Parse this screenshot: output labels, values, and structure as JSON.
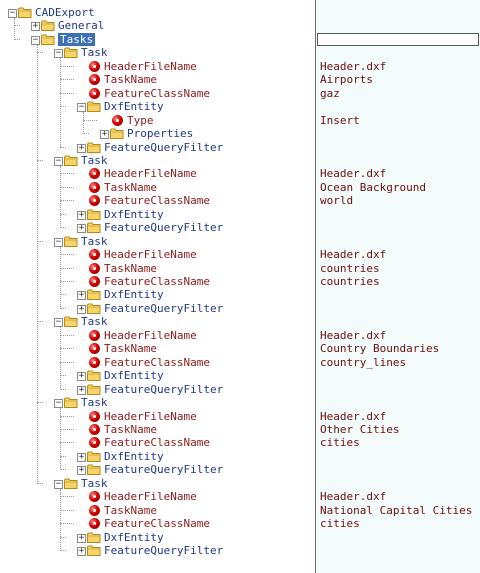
{
  "tree": [
    {
      "depth": 0,
      "kind": "folder",
      "label": "CADExport",
      "toggle": "-"
    },
    {
      "depth": 1,
      "kind": "folder",
      "label": "General",
      "toggle": "+"
    },
    {
      "depth": 1,
      "kind": "folder",
      "label": "Tasks",
      "toggle": "-",
      "selected": true,
      "editing": true
    },
    {
      "depth": 2,
      "kind": "folder",
      "label": "Task",
      "toggle": "-"
    },
    {
      "depth": 3,
      "kind": "leaf",
      "label": "HeaderFileName",
      "value": "Header.dxf"
    },
    {
      "depth": 3,
      "kind": "leaf",
      "label": "TaskName",
      "value": "Airports"
    },
    {
      "depth": 3,
      "kind": "leaf",
      "label": "FeatureClassName",
      "value": "gaz"
    },
    {
      "depth": 3,
      "kind": "folder",
      "label": "DxfEntity",
      "toggle": "-"
    },
    {
      "depth": 4,
      "kind": "leaf",
      "label": "Type",
      "value": "Insert"
    },
    {
      "depth": 4,
      "kind": "folder",
      "label": "Properties",
      "toggle": "+"
    },
    {
      "depth": 3,
      "kind": "folder",
      "label": "FeatureQueryFilter",
      "toggle": "+"
    },
    {
      "depth": 2,
      "kind": "folder",
      "label": "Task",
      "toggle": "-"
    },
    {
      "depth": 3,
      "kind": "leaf",
      "label": "HeaderFileName",
      "value": "Header.dxf"
    },
    {
      "depth": 3,
      "kind": "leaf",
      "label": "TaskName",
      "value": "Ocean Background"
    },
    {
      "depth": 3,
      "kind": "leaf",
      "label": "FeatureClassName",
      "value": "world"
    },
    {
      "depth": 3,
      "kind": "folder",
      "label": "DxfEntity",
      "toggle": "+"
    },
    {
      "depth": 3,
      "kind": "folder",
      "label": "FeatureQueryFilter",
      "toggle": "+"
    },
    {
      "depth": 2,
      "kind": "folder",
      "label": "Task",
      "toggle": "-"
    },
    {
      "depth": 3,
      "kind": "leaf",
      "label": "HeaderFileName",
      "value": "Header.dxf"
    },
    {
      "depth": 3,
      "kind": "leaf",
      "label": "TaskName",
      "value": "countries"
    },
    {
      "depth": 3,
      "kind": "leaf",
      "label": "FeatureClassName",
      "value": "countries"
    },
    {
      "depth": 3,
      "kind": "folder",
      "label": "DxfEntity",
      "toggle": "+"
    },
    {
      "depth": 3,
      "kind": "folder",
      "label": "FeatureQueryFilter",
      "toggle": "+"
    },
    {
      "depth": 2,
      "kind": "folder",
      "label": "Task",
      "toggle": "-"
    },
    {
      "depth": 3,
      "kind": "leaf",
      "label": "HeaderFileName",
      "value": "Header.dxf"
    },
    {
      "depth": 3,
      "kind": "leaf",
      "label": "TaskName",
      "value": "Country Boundaries"
    },
    {
      "depth": 3,
      "kind": "leaf",
      "label": "FeatureClassName",
      "value": "country_lines"
    },
    {
      "depth": 3,
      "kind": "folder",
      "label": "DxfEntity",
      "toggle": "+"
    },
    {
      "depth": 3,
      "kind": "folder",
      "label": "FeatureQueryFilter",
      "toggle": "+"
    },
    {
      "depth": 2,
      "kind": "folder",
      "label": "Task",
      "toggle": "-"
    },
    {
      "depth": 3,
      "kind": "leaf",
      "label": "HeaderFileName",
      "value": "Header.dxf"
    },
    {
      "depth": 3,
      "kind": "leaf",
      "label": "TaskName",
      "value": "Other Cities"
    },
    {
      "depth": 3,
      "kind": "leaf",
      "label": "FeatureClassName",
      "value": "cities"
    },
    {
      "depth": 3,
      "kind": "folder",
      "label": "DxfEntity",
      "toggle": "+"
    },
    {
      "depth": 3,
      "kind": "folder",
      "label": "FeatureQueryFilter",
      "toggle": "+"
    },
    {
      "depth": 2,
      "kind": "folder",
      "label": "Task",
      "toggle": "-"
    },
    {
      "depth": 3,
      "kind": "leaf",
      "label": "HeaderFileName",
      "value": "Header.dxf"
    },
    {
      "depth": 3,
      "kind": "leaf",
      "label": "TaskName",
      "value": "National Capital Cities"
    },
    {
      "depth": 3,
      "kind": "leaf",
      "label": "FeatureClassName",
      "value": "cities"
    },
    {
      "depth": 3,
      "kind": "folder",
      "label": "DxfEntity",
      "toggle": "+"
    },
    {
      "depth": 3,
      "kind": "folder",
      "label": "FeatureQueryFilter",
      "toggle": "+"
    }
  ],
  "colors": {
    "node_label": "#1f3a8a",
    "element_label": "#8b1c1c",
    "value_text": "#6b0f0f",
    "selection": "#3d6fb6",
    "values_pane_bg": "#f4fbfb"
  },
  "icons": {
    "folder": "folder-icon",
    "leaf": "element-icon",
    "expand": "expand-icon",
    "collapse": "collapse-icon"
  }
}
